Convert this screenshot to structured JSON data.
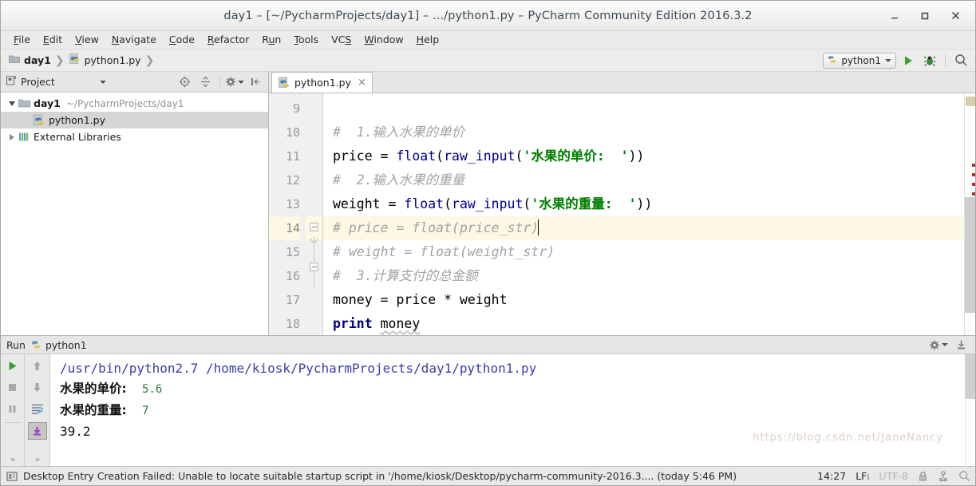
{
  "window": {
    "title": "day1 – [~/PycharmProjects/day1] – .../python1.py – PyCharm Community Edition 2016.3.2",
    "minimize_label": "_",
    "maximize_label": "□",
    "close_label": "×"
  },
  "menubar": {
    "items": [
      {
        "label": "File",
        "mnemonic": "F"
      },
      {
        "label": "Edit",
        "mnemonic": "E"
      },
      {
        "label": "View",
        "mnemonic": "V"
      },
      {
        "label": "Navigate",
        "mnemonic": "N"
      },
      {
        "label": "Code",
        "mnemonic": "C"
      },
      {
        "label": "Refactor",
        "mnemonic": "R"
      },
      {
        "label": "Run",
        "mnemonic": "u"
      },
      {
        "label": "Tools",
        "mnemonic": "T"
      },
      {
        "label": "VCS",
        "mnemonic": "S"
      },
      {
        "label": "Window",
        "mnemonic": "W"
      },
      {
        "label": "Help",
        "mnemonic": "H"
      }
    ]
  },
  "navbar": {
    "breadcrumbs": [
      {
        "label": "day1",
        "icon": "folder-icon"
      },
      {
        "label": "python1.py",
        "icon": "python-file-icon"
      }
    ],
    "separator": "❯",
    "run_config": "python1",
    "run_button": "run-icon",
    "debug_button": "debug-icon",
    "search_button": "search-icon"
  },
  "sidebar": {
    "title": "Project",
    "tools": [
      "target-icon",
      "collapse-all-icon",
      "settings-icon",
      "hide-icon"
    ],
    "tree": [
      {
        "label": "day1",
        "sub": "~/PycharmProjects/day1",
        "icon": "folder-icon",
        "expanded": true,
        "selected": false,
        "depth": 0
      },
      {
        "label": "python1.py",
        "sub": "",
        "icon": "python-file-icon",
        "expanded": null,
        "selected": true,
        "depth": 1
      },
      {
        "label": "External Libraries",
        "sub": "",
        "icon": "libraries-icon",
        "expanded": false,
        "selected": false,
        "depth": 0
      }
    ]
  },
  "editor": {
    "tab": {
      "label": "python1.py",
      "icon": "python-file-icon",
      "close": "×"
    },
    "first_line_number": 9,
    "highlighted_line": 14,
    "lines": [
      {
        "num": 9,
        "tokens": []
      },
      {
        "num": 10,
        "tokens": [
          {
            "t": "#  1.输入水果的单价",
            "c": "cmt"
          }
        ]
      },
      {
        "num": 11,
        "tokens": [
          {
            "t": "price = ",
            "c": "plain"
          },
          {
            "t": "float",
            "c": "fn"
          },
          {
            "t": "(",
            "c": "plain"
          },
          {
            "t": "raw_input",
            "c": "fn"
          },
          {
            "t": "(",
            "c": "plain"
          },
          {
            "t": "'水果的单价:  '",
            "c": "str"
          },
          {
            "t": "))",
            "c": "plain"
          }
        ]
      },
      {
        "num": 12,
        "tokens": [
          {
            "t": "#  2.输入水果的重量",
            "c": "cmt"
          }
        ]
      },
      {
        "num": 13,
        "tokens": [
          {
            "t": "weight = ",
            "c": "plain"
          },
          {
            "t": "float",
            "c": "fn"
          },
          {
            "t": "(",
            "c": "plain"
          },
          {
            "t": "raw_input",
            "c": "fn"
          },
          {
            "t": "(",
            "c": "plain"
          },
          {
            "t": "'水果的重量:  '",
            "c": "str"
          },
          {
            "t": "))",
            "c": "plain"
          }
        ]
      },
      {
        "num": 14,
        "tokens": [
          {
            "t": "# price = float(price_str)",
            "c": "cmt"
          }
        ],
        "caret": true
      },
      {
        "num": 15,
        "tokens": [
          {
            "t": "# weight = float(weight_str)",
            "c": "cmt"
          }
        ]
      },
      {
        "num": 16,
        "tokens": [
          {
            "t": "#  3.计算支付的总金额",
            "c": "cmt"
          }
        ]
      },
      {
        "num": 17,
        "tokens": [
          {
            "t": "money = price * weight",
            "c": "plain"
          }
        ]
      },
      {
        "num": 18,
        "tokens": [
          {
            "t": "print",
            "c": "kw"
          },
          {
            "t": " ",
            "c": "plain"
          },
          {
            "t": "money",
            "c": "squiggle"
          }
        ]
      }
    ]
  },
  "run_panel": {
    "header_label": "Run",
    "header_config": "python1",
    "tools_left": [
      "run-icon",
      "stop-icon",
      "pause-icon"
    ],
    "tools_right": [
      "scroll-up-icon",
      "scroll-down-icon",
      "soft-wrap-icon",
      "scroll-to-end-icon"
    ],
    "header_right": [
      "settings-icon",
      "export-icon"
    ],
    "output": [
      {
        "type": "command",
        "text": "/usr/bin/python2.7 /home/kiosk/PycharmProjects/day1/python1.py"
      },
      {
        "type": "prompt",
        "prompt": "水果的单价:",
        "value": "5.6"
      },
      {
        "type": "prompt",
        "prompt": "水果的重量:",
        "value": "7"
      },
      {
        "type": "result",
        "text": "39.2"
      }
    ]
  },
  "statusbar": {
    "icon": "notification-icon",
    "message": "Desktop Entry Creation Failed: Unable to locate suitable startup script in '/home/kiosk/Desktop/pycharm-community-2016.3.... (today 5:46 PM)",
    "caret_position": "14:27",
    "line_separator": "LF",
    "encoding": "UTF-8",
    "lock_icon": "lock-icon",
    "vcs_icon": "vcs-icon",
    "search_icon": "search-icon"
  },
  "watermark": "https://blog.csdn.net/JaneNancy",
  "colors": {
    "accent_green": "#2a7a34",
    "keyword_blue": "#000080",
    "string_green": "#008000",
    "comment_gray": "#a3a3a3",
    "highlight_line": "#fdf8e3",
    "selection_gray": "#d5d5d3"
  }
}
